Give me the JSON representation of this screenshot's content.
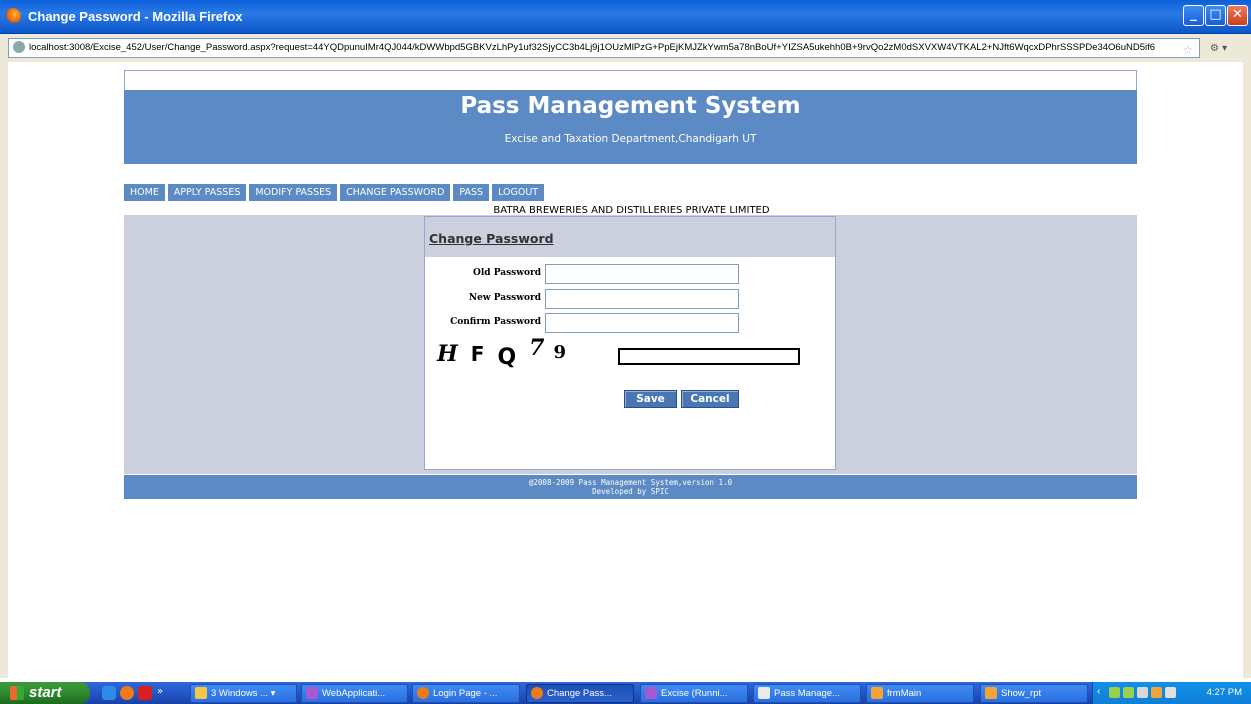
{
  "window": {
    "title": "Change Password - Mozilla Firefox",
    "url": "localhost:3008/Excise_452/User/Change_Password.aspx?request=44YQDpunuIMr4QJ044/kDWWbpd5GBKVzLhPy1uf32SjyCC3b4Lj9j1OUzMlPzG+PpEjKMJZkYwm5a78nBoUf+YIZSA5ukehh0B+9rvQo2zM0dSXVXW4VTKAL2+NJft6WqcxDPhrSSSPDe34O6uND5if6"
  },
  "header": {
    "title": "Pass Management System",
    "subtitle": "Excise and Taxation Department,Chandigarh UT"
  },
  "nav": [
    "HOME",
    "APPLY PASSES",
    "MODIFY PASSES",
    "CHANGE PASSWORD",
    "PASS",
    "LOGOUT"
  ],
  "company": "BATRA BREWERIES AND DISTILLERIES PRIVATE LIMITED",
  "form": {
    "heading": "Change Password",
    "old_label": "Old Password",
    "new_label": "New Password",
    "confirm_label": "Confirm Password",
    "old_value": "",
    "new_value": "",
    "confirm_value": "",
    "captcha_chars": [
      "H",
      "F",
      "Q",
      "7",
      "9"
    ],
    "captcha_value": "",
    "save_label": "Save",
    "cancel_label": "Cancel"
  },
  "footer": {
    "line1": "@2008-2009 Pass Management System,version 1.0",
    "line2": "Developed by SPIC"
  },
  "taskbar": {
    "start_label": "start",
    "tasks": [
      "3 Windows ...",
      "WebApplicati...",
      "Login Page - ...",
      "Change Pass...",
      "Excise (Runni...",
      "Pass Manage...",
      "frmMain",
      "Show_rpt"
    ],
    "active_task": "Change Pass...",
    "clock": "4:27 PM"
  }
}
